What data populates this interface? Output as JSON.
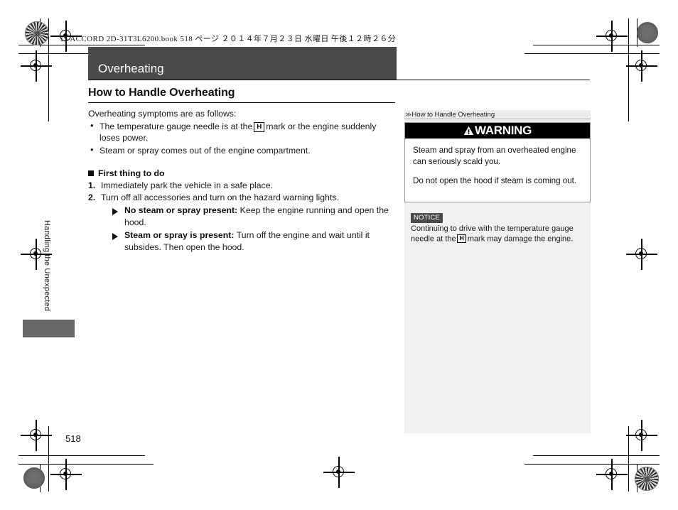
{
  "print_slug": "15 ACCORD 2D-31T3L6200.book   518 ページ   ２０１４年７月２３日   水曜日   午後１２時２６分",
  "chapter": {
    "title": "Overheating",
    "side_tab_label": "Handling the Unexpected"
  },
  "main": {
    "section_heading": "How to Handle Overheating",
    "intro": "Overheating symptoms are as follows:",
    "symptoms": [
      {
        "before": "The temperature gauge needle is at the",
        "glyph": "H",
        "after": "mark or the engine suddenly loses power."
      },
      {
        "before": "Steam or spray comes out of the engine compartment.",
        "glyph": "",
        "after": ""
      }
    ],
    "subhead": "First thing to do",
    "steps": [
      {
        "num": "1.",
        "text": "Immediately park the vehicle in a safe place."
      },
      {
        "num": "2.",
        "text": "Turn off all accessories and turn on the hazard warning lights."
      }
    ],
    "sub_items": [
      {
        "lead": "No steam or spray present:",
        "text": "Keep the engine running and open the hood."
      },
      {
        "lead": "Steam or spray is present:",
        "text": "Turn off the engine and wait until it subsides. Then open the hood."
      }
    ]
  },
  "sidebar": {
    "reference_label": "How to Handle Overheating",
    "reference_icon": "double-chevron-right-icon",
    "warning": {
      "icon": "warning-triangle-icon",
      "heading": "WARNING",
      "paragraphs": [
        "Steam and spray from an overheated engine can seriously scald you.",
        "Do not open the hood if steam is coming out."
      ]
    },
    "notice": {
      "badge": "NOTICE",
      "before": "Continuing to drive with the temperature gauge needle at the",
      "glyph": "H",
      "after": "mark may damage the engine."
    }
  },
  "page_number": "518",
  "colors": {
    "title_bar": "#4a4a4a",
    "warning_header": "#000000",
    "notice_badge": "#4a4a4a",
    "sidebar_panel": "#f1f1f1",
    "side_tab_block": "#666666"
  }
}
